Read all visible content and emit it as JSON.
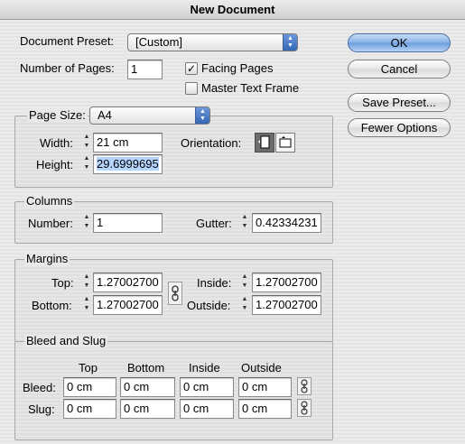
{
  "window": {
    "title": "New Document"
  },
  "document_preset": {
    "label": "Document Preset:",
    "value": "[Custom]"
  },
  "pages": {
    "label": "Number of Pages:",
    "value": "1",
    "facing_pages": {
      "label": "Facing Pages",
      "checked": true
    },
    "master_text_frame": {
      "label": "Master Text Frame",
      "checked": false
    }
  },
  "page_size": {
    "label": "Page Size:",
    "value": "A4",
    "width_label": "Width:",
    "width_value": "21 cm",
    "height_label": "Height:",
    "height_value": "29.6999695",
    "orientation_label": "Orientation:",
    "orientation_selected": "portrait"
  },
  "columns": {
    "title": "Columns",
    "number_label": "Number:",
    "number_value": "1",
    "gutter_label": "Gutter:",
    "gutter_value": "0.42334231"
  },
  "margins": {
    "title": "Margins",
    "top_label": "Top:",
    "top_value": "1.27002700",
    "bottom_label": "Bottom:",
    "bottom_value": "1.27002700",
    "inside_label": "Inside:",
    "inside_value": "1.27002700",
    "outside_label": "Outside:",
    "outside_value": "1.27002700"
  },
  "bleed_slug": {
    "title": "Bleed and Slug",
    "columns": [
      "Top",
      "Bottom",
      "Inside",
      "Outside"
    ],
    "bleed_label": "Bleed:",
    "bleed_values": [
      "0 cm",
      "0 cm",
      "0 cm",
      "0 cm"
    ],
    "slug_label": "Slug:",
    "slug_values": [
      "0 cm",
      "0 cm",
      "0 cm",
      "0 cm"
    ]
  },
  "buttons": {
    "ok": "OK",
    "cancel": "Cancel",
    "save_preset": "Save Preset...",
    "fewer_options": "Fewer Options"
  },
  "colors": {
    "default_button": "#87b0e6",
    "selection": "#b5d5ff"
  }
}
